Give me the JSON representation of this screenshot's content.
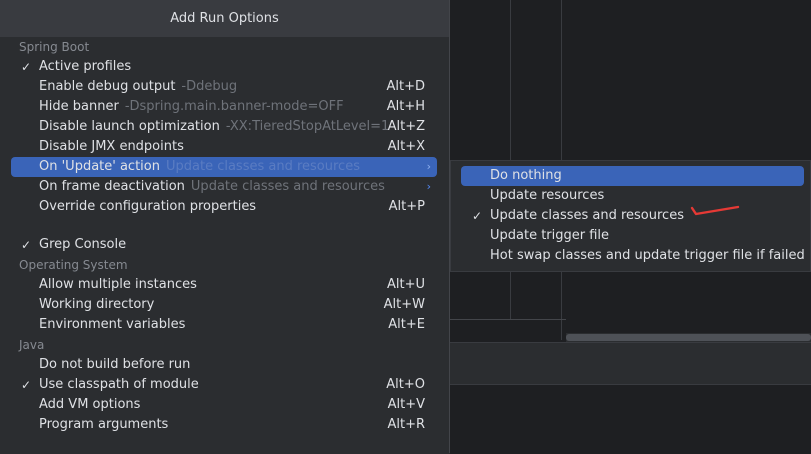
{
  "popup": {
    "title": "Add Run Options",
    "groups": [
      {
        "label": "Spring Boot",
        "items": [
          {
            "label": "Active profiles",
            "checked": true,
            "hint": "",
            "shortcut": ""
          },
          {
            "label": "Enable debug output",
            "checked": false,
            "hint": "-Ddebug",
            "shortcut": "Alt+D"
          },
          {
            "label": "Hide banner",
            "checked": false,
            "hint": "-Dspring.main.banner-mode=OFF",
            "shortcut": "Alt+H"
          },
          {
            "label": "Disable launch optimization",
            "checked": false,
            "hint": "-XX:TieredStopAtLevel=1",
            "shortcut": "Alt+Z"
          },
          {
            "label": "Disable JMX endpoints",
            "checked": false,
            "hint": "",
            "shortcut": "Alt+X"
          },
          {
            "label": "On 'Update' action",
            "checked": false,
            "hint": "Update classes and resources",
            "shortcut": "",
            "submenu": true,
            "selected": true
          },
          {
            "label": "On frame deactivation",
            "checked": false,
            "hint": "Update classes and resources",
            "shortcut": "",
            "submenu": true
          },
          {
            "label": "Override configuration properties",
            "checked": false,
            "hint": "",
            "shortcut": "Alt+P"
          }
        ]
      },
      {
        "label": "",
        "items": [
          {
            "label": "Grep Console",
            "checked": true,
            "hint": "",
            "shortcut": ""
          }
        ]
      },
      {
        "label": "Operating System",
        "items": [
          {
            "label": "Allow multiple instances",
            "checked": false,
            "hint": "",
            "shortcut": "Alt+U"
          },
          {
            "label": "Working directory",
            "checked": false,
            "hint": "",
            "shortcut": "Alt+W"
          },
          {
            "label": "Environment variables",
            "checked": false,
            "hint": "",
            "shortcut": "Alt+E"
          }
        ]
      },
      {
        "label": "Java",
        "items": [
          {
            "label": "Do not build before run",
            "checked": false,
            "hint": "",
            "shortcut": ""
          },
          {
            "label": "Use classpath of module",
            "checked": true,
            "hint": "",
            "shortcut": "Alt+O"
          },
          {
            "label": "Add VM options",
            "checked": false,
            "hint": "",
            "shortcut": "Alt+V"
          },
          {
            "label": "Program arguments",
            "checked": false,
            "hint": "",
            "shortcut": "Alt+R"
          }
        ]
      }
    ]
  },
  "submenu": {
    "items": [
      {
        "label": "Do nothing",
        "checked": false,
        "selected": true
      },
      {
        "label": "Update resources",
        "checked": false
      },
      {
        "label": "Update classes and resources",
        "checked": true
      },
      {
        "label": "Update trigger file",
        "checked": false
      },
      {
        "label": "Hot swap classes and update trigger file if failed",
        "checked": false
      }
    ]
  },
  "glyphs": {
    "check": "✓",
    "arrow": "›"
  },
  "colors": {
    "selection": "#3a64b8",
    "annotation": "#e53935",
    "arrow": "#548af7"
  }
}
